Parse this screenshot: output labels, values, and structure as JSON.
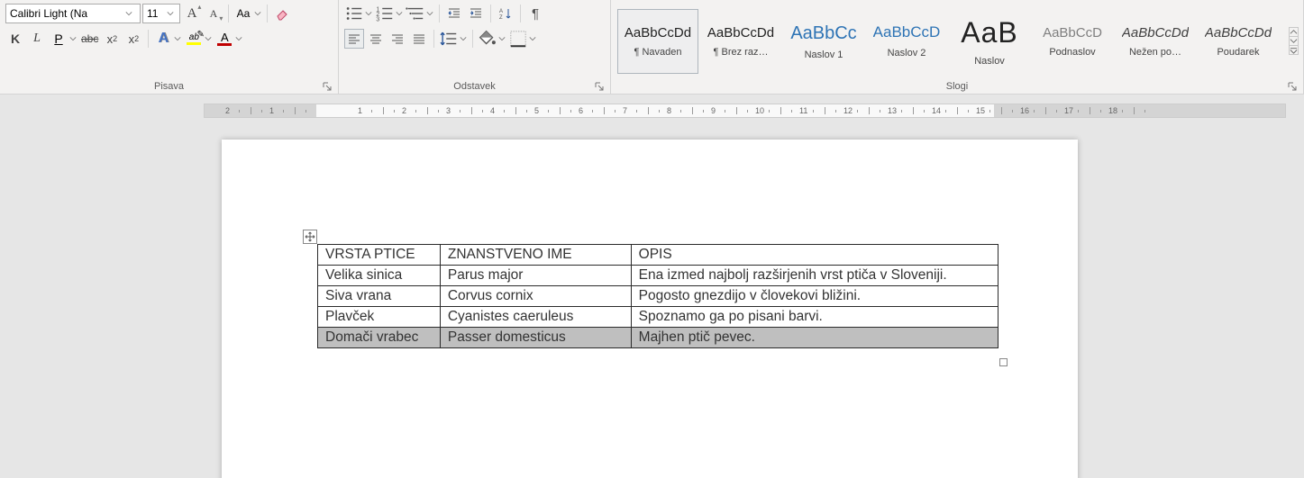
{
  "font_group": {
    "label": "Pisava",
    "font_name": "Calibri Light (Na",
    "font_size": "11",
    "buttons": {
      "grow": "A",
      "shrink": "A",
      "case": "Aa",
      "bold": "K",
      "italic": "L",
      "underline": "P",
      "strike": "abc",
      "subscript": "x",
      "subscript_2": "2",
      "superscript": "x",
      "superscript_2": "2",
      "text_effects": "A",
      "highlight": "ab",
      "font_color": "A"
    },
    "highlight_color": "#ffff00",
    "font_color_value": "#c00000",
    "text_effects_colors": [
      "#4472c4",
      "#ed7d31",
      "#a5a5a5"
    ]
  },
  "para_group": {
    "label": "Odstavek"
  },
  "styles_group": {
    "label": "Slogi",
    "items": [
      {
        "sample": "AaBbCcDd",
        "name": "¶ Navaden",
        "selected": true,
        "css": "font-size:15px;"
      },
      {
        "sample": "AaBbCcDd",
        "name": "¶ Brez raz…",
        "selected": false,
        "css": "font-size:15px;"
      },
      {
        "sample": "AaBbCc",
        "name": "Naslov 1",
        "selected": false,
        "css": "font-size:20px;color:#2e74b5;"
      },
      {
        "sample": "AaBbCcD",
        "name": "Naslov 2",
        "selected": false,
        "css": "font-size:17px;color:#2e74b5;"
      },
      {
        "sample": "AaB",
        "name": "Naslov",
        "selected": false,
        "css": "font-size:32px;letter-spacing:1px;"
      },
      {
        "sample": "AaBbCcD",
        "name": "Podnaslov",
        "selected": false,
        "css": "font-size:15px;color:#7f7f7f;"
      },
      {
        "sample": "AaBbCcDd",
        "name": "Nežen po…",
        "selected": false,
        "css": "font-size:15px;font-style:italic;color:#404040;"
      },
      {
        "sample": "AaBbCcDd",
        "name": "Poudarek",
        "selected": false,
        "css": "font-size:15px;font-style:italic;color:#404040;"
      }
    ]
  },
  "ruler": {
    "ticks": [
      -2,
      -1,
      1,
      2,
      3,
      4,
      5,
      6,
      7,
      8,
      9,
      10,
      11,
      12,
      13,
      14,
      15,
      16,
      17,
      18
    ]
  },
  "table": {
    "headers": [
      "VRSTA PTICE",
      "ZNANSTVENO IME",
      "OPIS"
    ],
    "rows": [
      [
        "Velika sinica",
        "Parus major",
        "Ena izmed najbolj razširjenih vrst ptiča v Sloveniji."
      ],
      [
        "Siva vrana",
        "Corvus cornix",
        "Pogosto gnezdijo v človekovi bližini."
      ],
      [
        "Plavček",
        "Cyanistes caeruleus",
        "Spoznamo ga po pisani barvi."
      ],
      [
        "Domači vrabec",
        "Passer domesticus",
        "Majhen ptič pevec."
      ]
    ],
    "selected_row": 3
  }
}
